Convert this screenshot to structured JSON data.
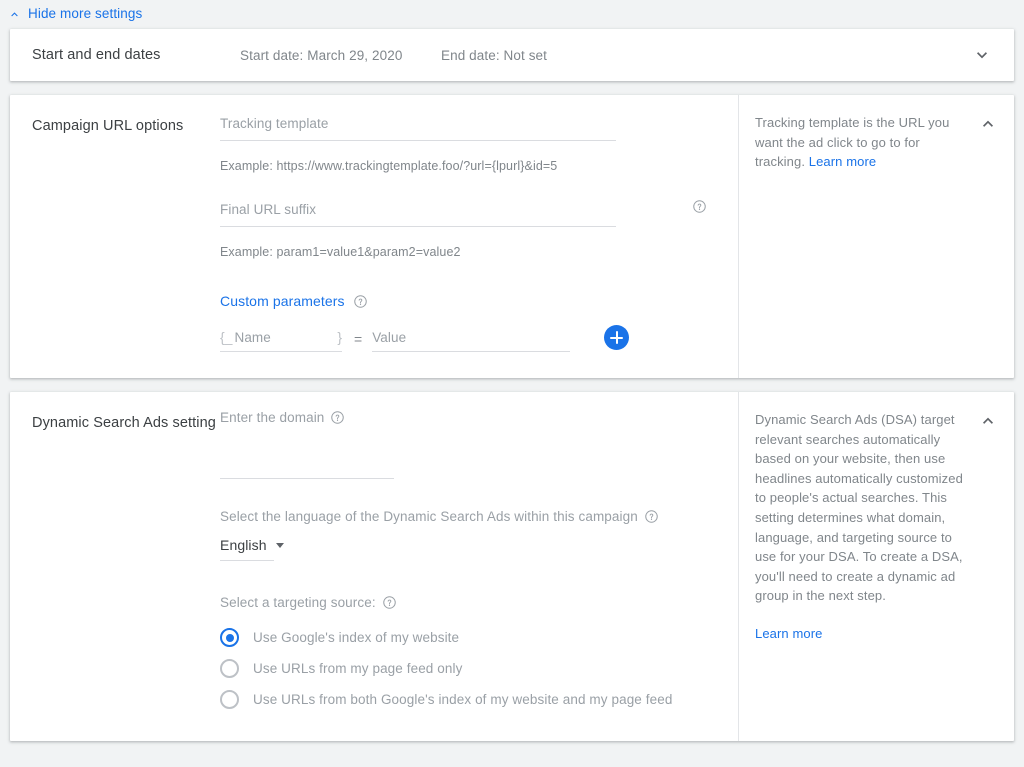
{
  "top_bar": {
    "hide_settings_label": "Hide more settings",
    "chevron_icon": "chevron-up-icon"
  },
  "colors": {
    "accent_blue": "#1a73e8",
    "page_background": "#f1f3f4",
    "card_background": "#ffffff",
    "muted_text": "#80868b",
    "placeholder_text": "#9aa0a6"
  },
  "dates_section": {
    "title": "Start and end dates",
    "start_date": "Start date: March 29, 2020",
    "end_date": "End date: Not set",
    "expand_icon": "chevron-down-icon"
  },
  "url_options_section": {
    "title": "Campaign URL options",
    "tracking_template": {
      "label": "Tracking template",
      "value": "",
      "example": "Example: https://www.trackingtemplate.foo/?url={lpurl}&id=5"
    },
    "final_url_suffix": {
      "label": "Final URL suffix",
      "value": "",
      "example": "Example: param1=value1&param2=value2",
      "help_icon": "help-circle-icon"
    },
    "custom_parameters": {
      "label": "Custom parameters",
      "help_icon": "help-circle-icon",
      "brace_left": "{_",
      "brace_right": "}",
      "name_placeholder": "Name",
      "name_value": "",
      "equals": "=",
      "value_placeholder": "Value",
      "value_value": "",
      "add_icon": "plus-icon"
    },
    "help_panel": {
      "text": "Tracking template is the URL you want the ad click to go to for tracking. ",
      "learn_more": "Learn more",
      "collapse_icon": "chevron-up-icon"
    }
  },
  "dsa_section": {
    "title": "Dynamic Search Ads setting",
    "domain": {
      "label": "Enter the domain",
      "help_icon": "help-circle-icon",
      "value": "",
      "placeholder": ""
    },
    "language": {
      "label": "Select the language of the Dynamic Search Ads within this campaign",
      "help_icon": "help-circle-icon",
      "selected": "English",
      "caret_icon": "caret-down-icon"
    },
    "targeting": {
      "label": "Select a targeting source:",
      "help_icon": "help-circle-icon",
      "options": [
        {
          "label": "Use Google's index of my website",
          "checked": true
        },
        {
          "label": "Use URLs from my page feed only",
          "checked": false
        },
        {
          "label": "Use URLs from both Google's index of my website and my page feed",
          "checked": false
        }
      ]
    },
    "help_panel": {
      "text": "Dynamic Search Ads (DSA) target relevant searches automatically based on your website, then use headlines automatically customized to people's actual searches. This setting determines what domain, language, and targeting source to use for your DSA. To create a DSA, you'll need to create a dynamic ad group in the next step.",
      "learn_more": "Learn more",
      "collapse_icon": "chevron-up-icon"
    }
  }
}
